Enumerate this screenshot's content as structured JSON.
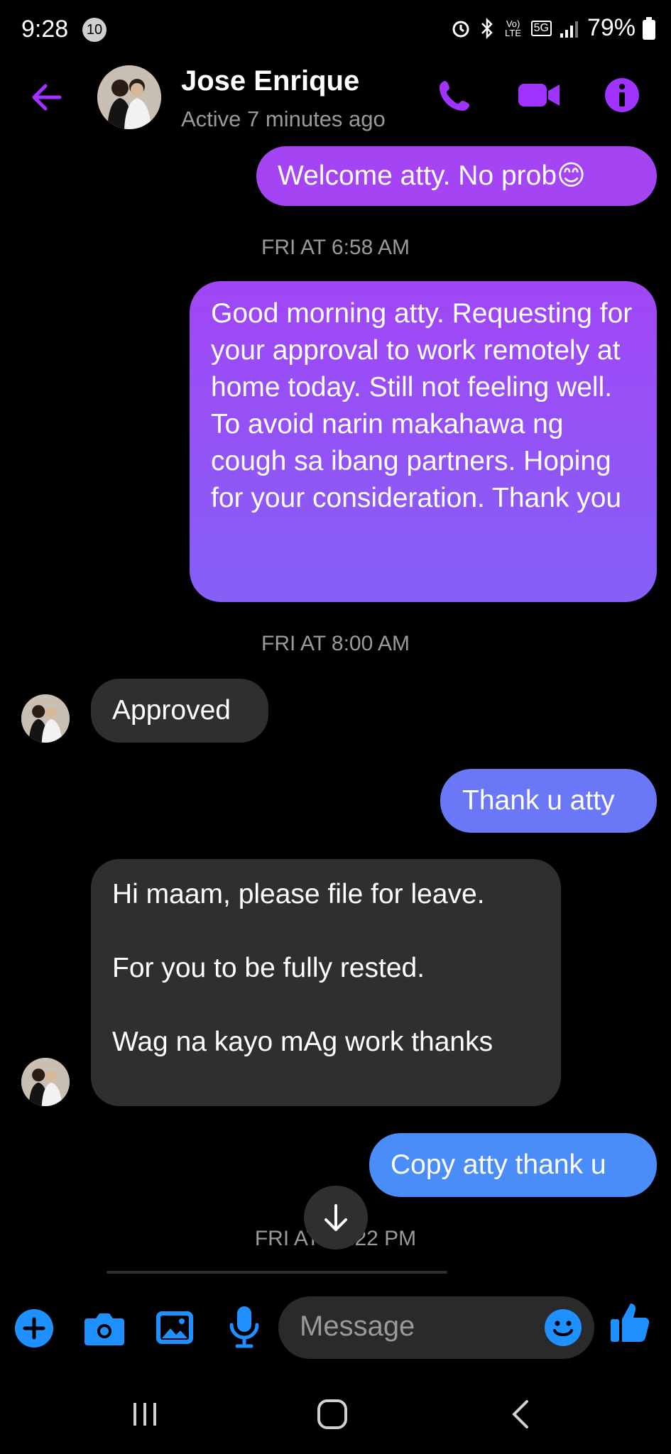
{
  "status_bar": {
    "time": "9:28",
    "notification_count": "10",
    "network_label_1": "Vo) LTE",
    "network_label_2": "5G",
    "battery": "79%"
  },
  "header": {
    "contact_name": "Jose Enrique",
    "status": "Active 7 minutes ago"
  },
  "messages": [
    {
      "type": "sent",
      "text": "Welcome atty. No prob😊"
    },
    {
      "type": "timestamp",
      "text": "FRI AT 6:58 AM"
    },
    {
      "type": "sent",
      "text": "Good morning atty. Requesting for your approval to work remotely at home today. Still not feeling well. To avoid narin makahawa ng cough sa ibang partners. Hoping for your consideration. Thank you"
    },
    {
      "type": "timestamp",
      "text": "FRI AT 8:00 AM"
    },
    {
      "type": "received",
      "text": "Approved"
    },
    {
      "type": "sent",
      "text": "Thank u atty"
    },
    {
      "type": "received",
      "text": "Hi maam, please file for leave.\n\nFor you to be fully rested.\n\nWag na kayo mAg work thanks"
    },
    {
      "type": "sent",
      "text": "Copy atty thank u"
    },
    {
      "type": "timestamp",
      "text": "FRI AT 12:22 PM"
    }
  ],
  "composer": {
    "placeholder": "Message"
  },
  "colors": {
    "accent": "#a033ff",
    "bubble_top": "#a544f2",
    "bubble_mid": "#8a5cf6",
    "bubble_bottom": "#4b8df8",
    "received_bubble": "#2f2f2f",
    "composer_blue": "#1e90ff"
  },
  "icons": [
    "back-arrow-icon",
    "phone-icon",
    "video-icon",
    "info-icon",
    "plus-icon",
    "camera-icon",
    "gallery-icon",
    "mic-icon",
    "emoji-icon",
    "thumbs-up-icon",
    "scroll-down-icon",
    "recents-icon",
    "home-icon",
    "nav-back-icon"
  ]
}
